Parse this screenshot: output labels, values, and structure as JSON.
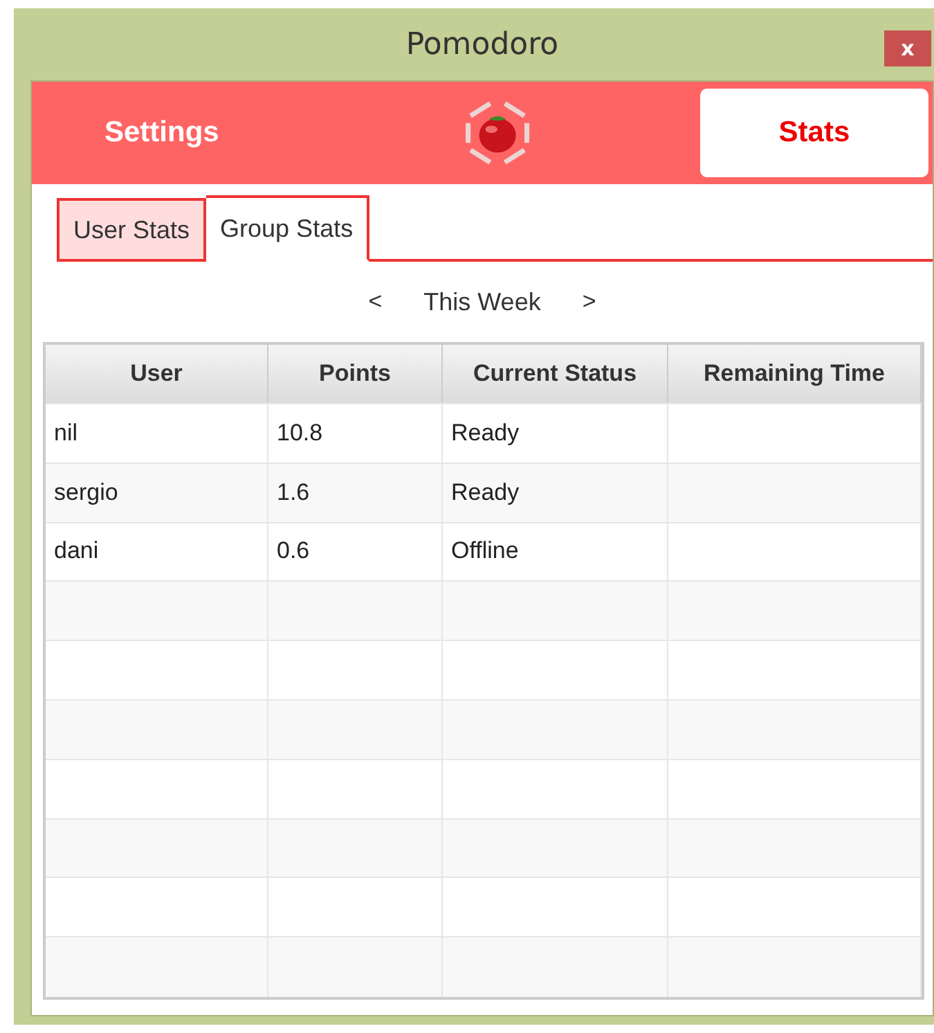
{
  "window": {
    "title": "Pomodoro",
    "close": "x"
  },
  "nav": [
    {
      "label": "Settings",
      "selected": false
    },
    {
      "label": "Stats",
      "selected": true
    }
  ],
  "tabs": [
    {
      "label": "User Stats",
      "selected": false
    },
    {
      "label": "Group Stats",
      "selected": true
    }
  ],
  "period": {
    "prev": "<",
    "label": "This Week",
    "next": ">"
  },
  "table": {
    "columns": [
      "User",
      "Points",
      "Current Status",
      "Remaining Time"
    ],
    "rows": [
      [
        "nil",
        "10.8",
        "Ready",
        ""
      ],
      [
        "sergio",
        "1.6",
        "Ready",
        ""
      ],
      [
        "dani",
        "0.6",
        "Offline",
        ""
      ]
    ]
  }
}
